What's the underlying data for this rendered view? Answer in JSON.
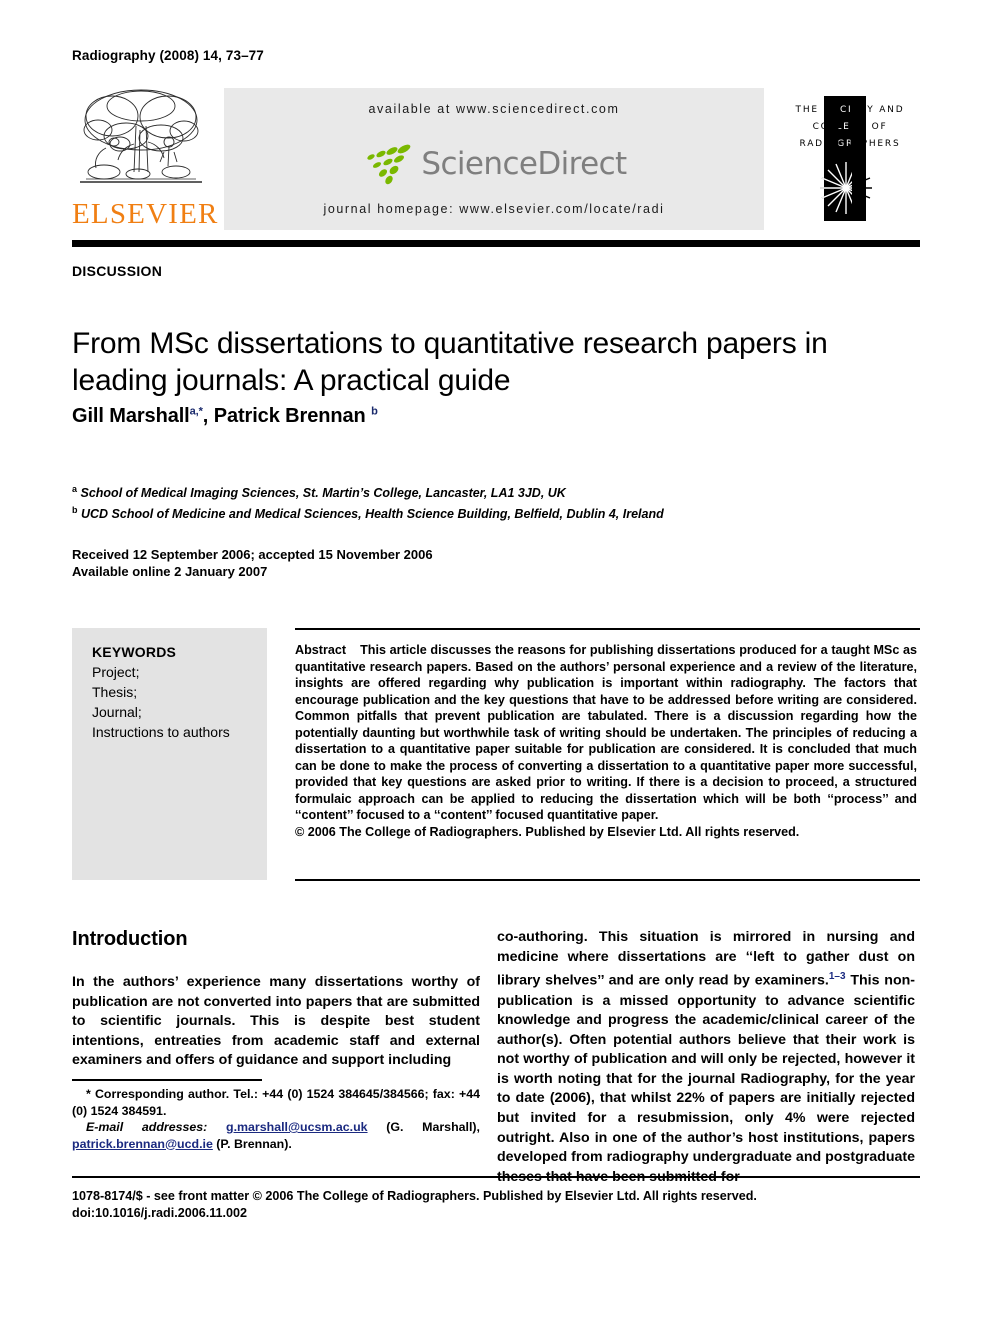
{
  "running_head": "Radiography (2008) 14, 73–77",
  "masthead": {
    "elsevier_wordmark": "ELSEVIER",
    "available_at": "available at www.sciencedirect.com",
    "sciencedirect_wordmark": "ScienceDirect",
    "journal_homepage": "journal homepage: www.elsevier.com/locate/radi",
    "society_logo_lines": [
      "THE SOCIETY AND",
      "COLLEGE OF",
      "RADIOGRAPHERS"
    ],
    "colors": {
      "elsevier_orange": "#f07f13",
      "sciencedirect_green": "#7ab800",
      "sciencedirect_gray": "#7f7f7f",
      "banner_gray": "#e9e9e9"
    }
  },
  "article": {
    "kicker": "DISCUSSION",
    "title": "From MSc dissertations to quantitative research papers in leading journals: A practical guide",
    "authors": [
      {
        "name": "Gill Marshall",
        "markers": "a,*"
      },
      {
        "name": "Patrick Brennan",
        "markers": "b"
      }
    ],
    "affiliations": [
      {
        "marker": "a",
        "text": "School of Medical Imaging Sciences, St. Martin’s College, Lancaster, LA1 3JD, UK"
      },
      {
        "marker": "b",
        "text": "UCD School of Medicine and Medical Sciences, Health Science Building, Belfield, Dublin 4, Ireland"
      }
    ],
    "dates": [
      "Received 12 September 2006; accepted 15 November 2006",
      "Available online 2 January 2007"
    ]
  },
  "keywords": {
    "heading": "KEYWORDS",
    "items": [
      "Project;",
      "Thesis;",
      "Journal;",
      "Instructions to authors"
    ]
  },
  "abstract": {
    "label": "Abstract",
    "text": "This article discusses the reasons for publishing dissertations produced for a taught MSc as quantitative research papers. Based on the authors’ personal experience and a review of the literature, insights are offered regarding why publication is important within radiography. The factors that encourage publication and the key questions that have to be addressed before writing are considered. Common pitfalls that prevent publication are tabulated. There is a discussion regarding how the potentially daunting but worthwhile task of writing should be undertaken. The principles of reducing a dissertation to a quantitative paper suitable for publication are considered. It is concluded that much can be done to make the process of converting a dissertation to a quantitative paper more successful, provided that key questions are asked prior to writing. If there is a decision to proceed, a structured formulaic approach can be applied to reducing the dissertation which will be both ‘‘process’’ and ‘‘content’’ focused to a ‘‘content’’ focused quantitative paper.",
    "copyright": "© 2006 The College of Radiographers. Published by Elsevier Ltd. All rights reserved."
  },
  "body": {
    "heading": "Introduction",
    "left_column": "In the authors’ experience many dissertations worthy of publication are not converted into papers that are submitted to scientific journals. This is despite best student intentions, entreaties from academic staff and external examiners and offers of guidance and support including",
    "right_column_part1": "co-authoring. This situation is mirrored in nursing and medicine where dissertations are ‘‘left to gather dust on library shelves’’ and are only read by examiners.",
    "right_column_citation": "1–3",
    "right_column_part2": " This non-publication is a missed opportunity to advance scientific knowledge and progress the academic/clinical career of the author(s). Often potential authors believe that their work is not worthy of publication and will only be rejected, however it is worth noting that for the journal Radiography, for the year to date (2006), that whilst 22% of papers are initially rejected but invited for a resubmission, only 4% were rejected outright. Also in one of the author’s host institutions, papers developed from radiography undergraduate and postgraduate theses that have been submitted for"
  },
  "footnote": {
    "corresponding": "* Corresponding author. Tel.: +44 (0) 1524 384645/384566; fax: +44 (0) 1524 384591.",
    "email_label": "E-mail addresses:",
    "email1": "g.marshall@ucsm.ac.uk",
    "email1_name": "(G. Marshall),",
    "email2": "patrick.brennan@ucd.ie",
    "email2_name": "(P. Brennan)."
  },
  "page_footer": {
    "line1": "1078-8174/$ - see front matter © 2006 The College of Radiographers. Published by Elsevier Ltd. All rights reserved.",
    "line2": "doi:10.1016/j.radi.2006.11.002"
  }
}
